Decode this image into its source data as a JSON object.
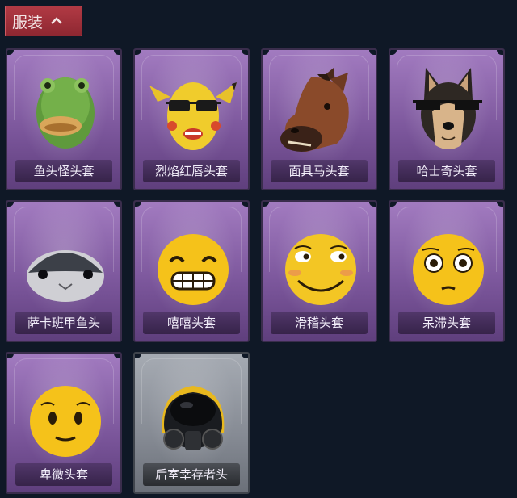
{
  "category_button": {
    "label": "服装",
    "icon": "chevron-up-icon"
  },
  "items": [
    {
      "name": "鱼头怪头套",
      "icon": "fish-monster-mask-icon",
      "rarity": "purple"
    },
    {
      "name": "烈焰红唇头套",
      "icon": "yellow-mouse-mask-icon",
      "rarity": "purple"
    },
    {
      "name": "面具马头套",
      "icon": "horse-mask-icon",
      "rarity": "purple"
    },
    {
      "name": "哈士奇头套",
      "icon": "husky-mask-icon",
      "rarity": "purple"
    },
    {
      "name": "萨卡班甲鱼头",
      "icon": "sacabambaspis-mask-icon",
      "rarity": "purple"
    },
    {
      "name": "嘻嘻头套",
      "icon": "grin-emoji-mask-icon",
      "rarity": "purple"
    },
    {
      "name": "滑稽头套",
      "icon": "funny-emoji-mask-icon",
      "rarity": "purple"
    },
    {
      "name": "呆滞头套",
      "icon": "dazed-emoji-mask-icon",
      "rarity": "purple"
    },
    {
      "name": "卑微头套",
      "icon": "humble-emoji-mask-icon",
      "rarity": "purple"
    },
    {
      "name": "后室幸存者头",
      "icon": "gas-mask-helmet-icon",
      "rarity": "grey"
    }
  ]
}
